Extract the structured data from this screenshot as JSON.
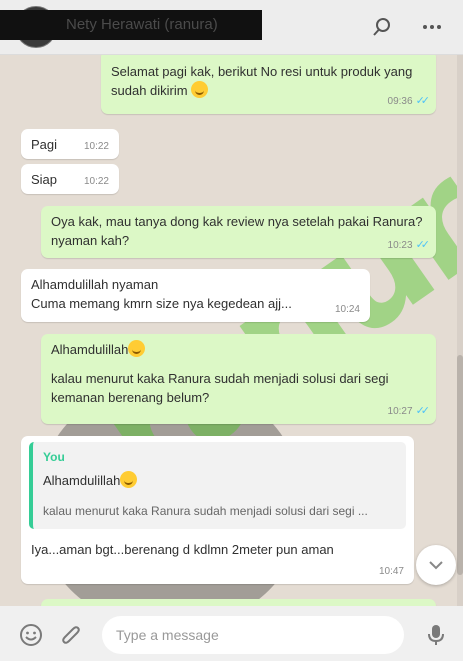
{
  "header": {
    "contact_name": "Nety Herawati (ranura)",
    "search_icon": "search-icon",
    "menu_icon": "more-icon"
  },
  "messages": [
    {
      "dir": "out",
      "text": "Selamat pagi kak, berikut No resi untuk produk yang sudah dikirim",
      "time": "09:36",
      "emoji": true
    },
    {
      "dir": "in",
      "text": "Pagi",
      "time": "10:22"
    },
    {
      "dir": "in",
      "text": "Siap",
      "time": "10:22"
    },
    {
      "dir": "out",
      "text": "Oya kak, mau tanya dong kak review nya setelah pakai Ranura? nyaman kah?",
      "time": "10:23"
    },
    {
      "dir": "in",
      "line1": "Alhamdulillah nyaman",
      "line2": "Cuma memang kmrn size nya kegedean ajj...",
      "time": "10:24"
    },
    {
      "dir": "out",
      "line1": "Alhamdulillah",
      "line2": "kalau menurut kaka Ranura sudah menjadi solusi dari segi kemanan berenang belum?",
      "time": "10:27",
      "emoji": true
    },
    {
      "dir": "in",
      "quote_author": "You",
      "quote_line1": "Alhamdulillah",
      "quote_line2": "kalau menurut kaka Ranura sudah menjadi solusi dari segi ...",
      "text": "Iya...aman bgt...berenang d kdlmn 2meter pun aman",
      "time": "10:47"
    }
  ],
  "watermark": "ranura",
  "footer": {
    "placeholder": "Type a message",
    "emoji_icon": "emoji-icon",
    "attach_icon": "paperclip-icon",
    "mic_icon": "microphone-icon"
  },
  "colors": {
    "outgoing_bubble": "#dcf8c6",
    "incoming_bubble": "#ffffff",
    "read_ticks": "#4fc3f7",
    "quote_accent": "#35cd96"
  }
}
